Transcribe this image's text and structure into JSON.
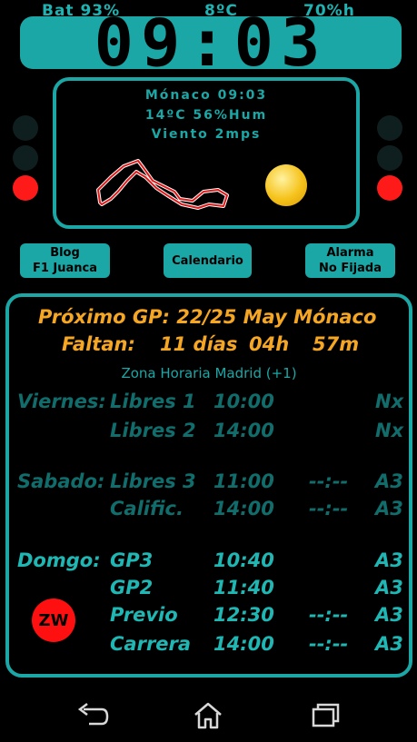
{
  "status": {
    "battery": "Bat 93%",
    "temperature": "8ºC",
    "humidity": "70%h"
  },
  "clock": {
    "time": "09:03"
  },
  "weather": {
    "line1": "Mónaco   09:03",
    "line2": "14ºC  56%Hum",
    "line3": "Viento 2mps",
    "icon": "sun-cloud-icon"
  },
  "buttons": {
    "blog_line1": "Blog",
    "blog_line2": "F1 Juanca",
    "calendar": "Calendario",
    "alarm_line1": "Alarma",
    "alarm_line2": "No Fijada"
  },
  "next_gp": {
    "label": "Próximo GP: 22/25 May  Mónaco",
    "remaining_label": "Faltan:",
    "days": "11 días",
    "hours": "04h",
    "minutes": "57m",
    "timezone": "Zona Horaria Madrid (+1)"
  },
  "schedule": [
    {
      "day": "Viernes:",
      "session": "Libres 1",
      "time": "10:00",
      "extra": "",
      "channel": "Nx",
      "active": false
    },
    {
      "day": "",
      "session": "Libres 2",
      "time": "14:00",
      "extra": "",
      "channel": "Nx",
      "active": false
    },
    {
      "day": "Sabado:",
      "session": "Libres 3",
      "time": "11:00",
      "extra": "--:--",
      "channel": "A3",
      "active": false
    },
    {
      "day": "",
      "session": "Calific.",
      "time": "14:00",
      "extra": "--:--",
      "channel": "A3",
      "active": false
    },
    {
      "day": "Domgo:",
      "session": "GP3",
      "time": "10:40",
      "extra": "",
      "channel": "A3",
      "active": true
    },
    {
      "day": "",
      "session": "GP2",
      "time": "11:40",
      "extra": "",
      "channel": "A3",
      "active": true
    },
    {
      "day": "",
      "session": "Previo",
      "time": "12:30",
      "extra": "--:--",
      "channel": "A3",
      "active": true
    },
    {
      "day": "",
      "session": "Carrera",
      "time": "14:00",
      "extra": "--:--",
      "channel": "A3",
      "active": true
    }
  ],
  "badge": {
    "label": "ZW"
  },
  "colors": {
    "accent": "#1aa7a5",
    "orange": "#f5a623",
    "red": "#ff1a1a"
  }
}
